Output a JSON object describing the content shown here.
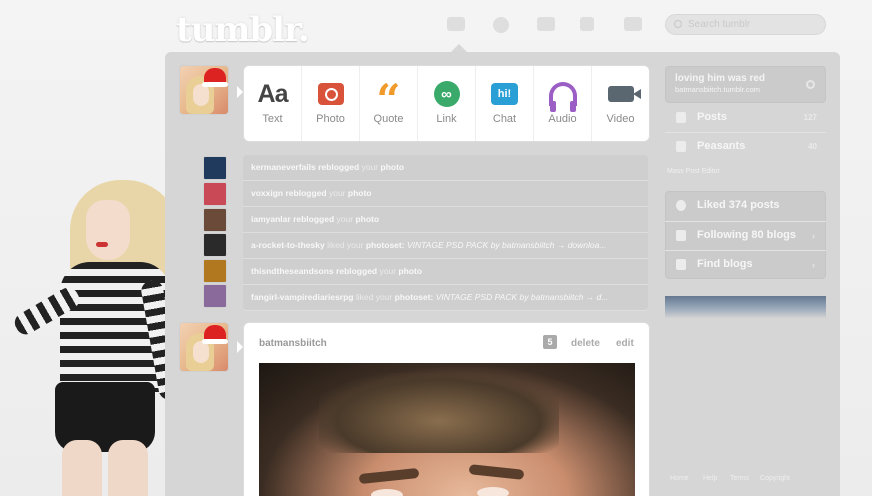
{
  "header": {
    "logo": "tumblr.",
    "search_placeholder": "Search tumblr"
  },
  "post_types": [
    {
      "label": "Text",
      "icon": "text-icon",
      "glyph": "Aa"
    },
    {
      "label": "Photo",
      "icon": "camera-icon",
      "glyph": ""
    },
    {
      "label": "Quote",
      "icon": "quote-icon",
      "glyph": "“"
    },
    {
      "label": "Link",
      "icon": "link-icon",
      "glyph": "∞"
    },
    {
      "label": "Chat",
      "icon": "chat-icon",
      "glyph": "hi!"
    },
    {
      "label": "Audio",
      "icon": "headphones-icon",
      "glyph": ""
    },
    {
      "label": "Video",
      "icon": "video-camera-icon",
      "glyph": ""
    }
  ],
  "notifications": [
    {
      "user": "kermaneverfails",
      "action": "reblogged",
      "your": "your",
      "type": "photo",
      "extra": "",
      "avatar_color": "#203a5a"
    },
    {
      "user": "voxxign",
      "action": "reblogged",
      "your": "your",
      "type": "photo",
      "extra": "",
      "avatar_color": "#c94a56"
    },
    {
      "user": "iamyanlar",
      "action": "reblogged",
      "your": "your",
      "type": "photo",
      "extra": "",
      "avatar_color": "#6b4a3a"
    },
    {
      "user": "a-rocket-to-thesky",
      "action": "liked",
      "your": "your",
      "type": "photoset:",
      "extra": "VINTAGE PSD PACK by batmansbiitch → downloa...",
      "avatar_color": "#2a2a2a"
    },
    {
      "user": "thisndtheseandsons",
      "action": "reblogged",
      "your": "your",
      "type": "photo",
      "extra": "",
      "avatar_color": "#b27820"
    },
    {
      "user": "fangirl-vampirediariesrpg",
      "action": "liked",
      "your": "your",
      "type": "photoset:",
      "extra": "VINTAGE PSD PACK by batmansbiitch → d...",
      "avatar_color": "#8a6a9a"
    }
  ],
  "post": {
    "author": "batmansbiitch",
    "note_count": "5",
    "delete_label": "delete",
    "edit_label": "edit"
  },
  "sidebar": {
    "blog_title": "loving him was red",
    "blog_url": "batmansbiitch.tumblr.com",
    "posts_label": "Posts",
    "posts_count": "127",
    "peasants_label": "Peasants",
    "peasants_count": "40",
    "mass_editor": "Mass Post Editor",
    "liked_label": "Liked 374 posts",
    "following_label": "Following 80 blogs",
    "find_label": "Find blogs"
  },
  "footer": [
    "Home",
    "Help",
    "Terms",
    "Copyright"
  ]
}
